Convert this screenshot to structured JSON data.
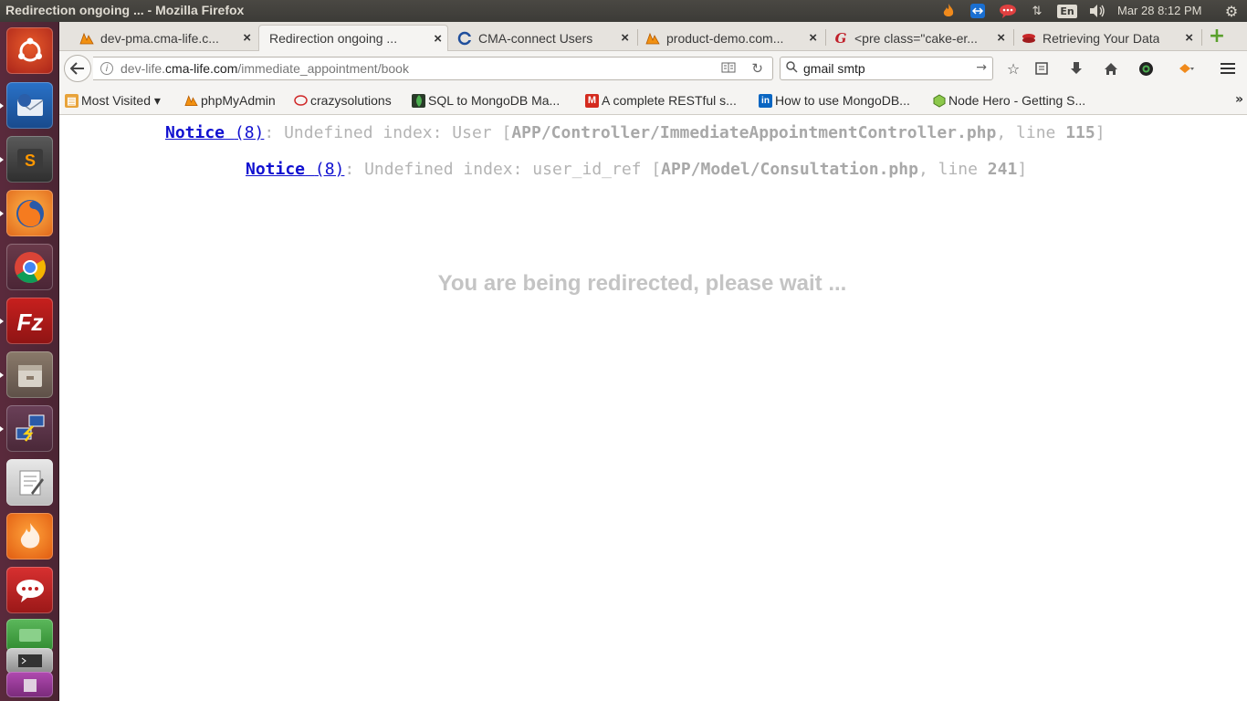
{
  "window": {
    "title": "Redirection ongoing ... - Mozilla Firefox"
  },
  "tray": {
    "lang": "En",
    "clock": "Mar 28  8:12 PM"
  },
  "launcher": {
    "items": [
      "ubuntu-dash",
      "thunderbird",
      "sublime-text",
      "firefox",
      "chrome",
      "filezilla",
      "files",
      "network-manager",
      "text-editor",
      "soundcloud",
      "pidgin",
      "workspaces",
      "terminal"
    ]
  },
  "tabs": [
    {
      "title": "dev-pma.cma-life.c...",
      "icon": "pma-icon"
    },
    {
      "title": "Redirection ongoing ...",
      "icon": "none"
    },
    {
      "title": "CMA-connect Users",
      "icon": "cma-icon"
    },
    {
      "title": "product-demo.com...",
      "icon": "pma-icon"
    },
    {
      "title": "<pre class=\"cake-er...",
      "icon": "g-icon"
    },
    {
      "title": "Retrieving Your Data",
      "icon": "stack-icon"
    }
  ],
  "navbar": {
    "url_prefix": "dev-life.",
    "url_host": "cma-life.com",
    "url_path": "/immediate_appointment/book",
    "search_value": "gmail smtp"
  },
  "bookmarks": {
    "items": [
      {
        "label": "Most Visited ▾",
        "icon": "most-visited-icon"
      },
      {
        "label": "phpMyAdmin",
        "icon": "pma-icon"
      },
      {
        "label": "crazysolutions",
        "icon": "chat-icon"
      },
      {
        "label": "SQL to MongoDB Ma...",
        "icon": "mongo-icon"
      },
      {
        "label": "A complete RESTful s...",
        "icon": "m-icon"
      },
      {
        "label": "How to use MongoDB...",
        "icon": "linkedin-icon"
      },
      {
        "label": "Node Hero - Getting S...",
        "icon": "node-icon"
      }
    ],
    "overflow": "»"
  },
  "page": {
    "notices": [
      {
        "label": "Notice",
        "code": "(8)",
        "message": ": Undefined index: User [",
        "file": "APP/Controller/ImmediateAppointmentController.php",
        "line_label": ", line ",
        "line": "115",
        "close": "]"
      },
      {
        "label": "Notice",
        "code": "(8)",
        "message": ": Undefined index: user_id_ref [",
        "file": "APP/Model/Consultation.php",
        "line_label": ", line ",
        "line": "241",
        "close": "]"
      }
    ],
    "redirect_message": "You are being redirected, please wait ..."
  },
  "colors": {
    "link": "#1010d0",
    "notice_text": "#b4b4b4",
    "redirect_text": "#c4c4c4",
    "launcher_bg": "#5a2a3c"
  }
}
